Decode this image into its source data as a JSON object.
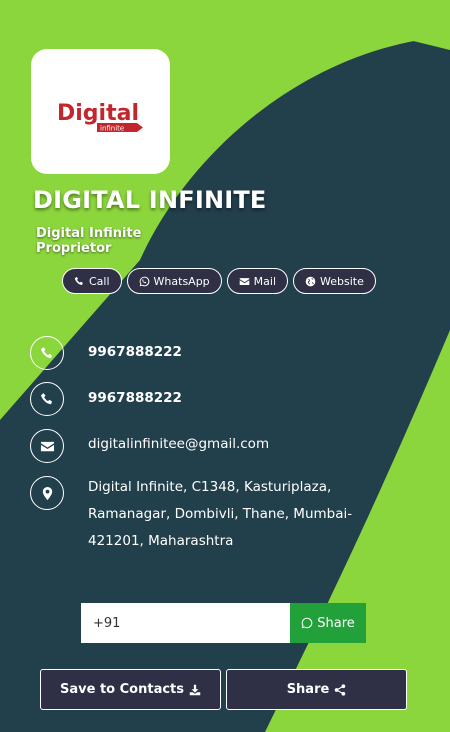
{
  "profile": {
    "company": "DIGITAL INFINITE",
    "person_name": "Digital Infinite",
    "title": "Proprietor",
    "logo": {
      "word": "Digital",
      "sub": "infinite"
    }
  },
  "actions": [
    {
      "label": "Call",
      "icon": "phone-icon"
    },
    {
      "label": "WhatsApp",
      "icon": "whatsapp-icon"
    },
    {
      "label": "Mail",
      "icon": "mail-icon"
    },
    {
      "label": "Website",
      "icon": "globe-icon"
    }
  ],
  "contact": {
    "phone1": "9967888222",
    "phone2": "9967888222",
    "email": "digitalinfinitee@gmail.com",
    "address": "Digital Infinite, C1348, Kasturiplaza, Ramanagar, Dombivli, Thane, Mumbai-421201, Maharashtra"
  },
  "share": {
    "input_value": "+91",
    "button_label": "Share"
  },
  "bottom": {
    "save_label": "Save to Contacts",
    "share_label": "Share"
  },
  "colors": {
    "background_dark": "#223f4c",
    "accent_green": "#8bd63c",
    "button_dark": "#2f2f45",
    "whatsapp_green": "#22a13a"
  }
}
